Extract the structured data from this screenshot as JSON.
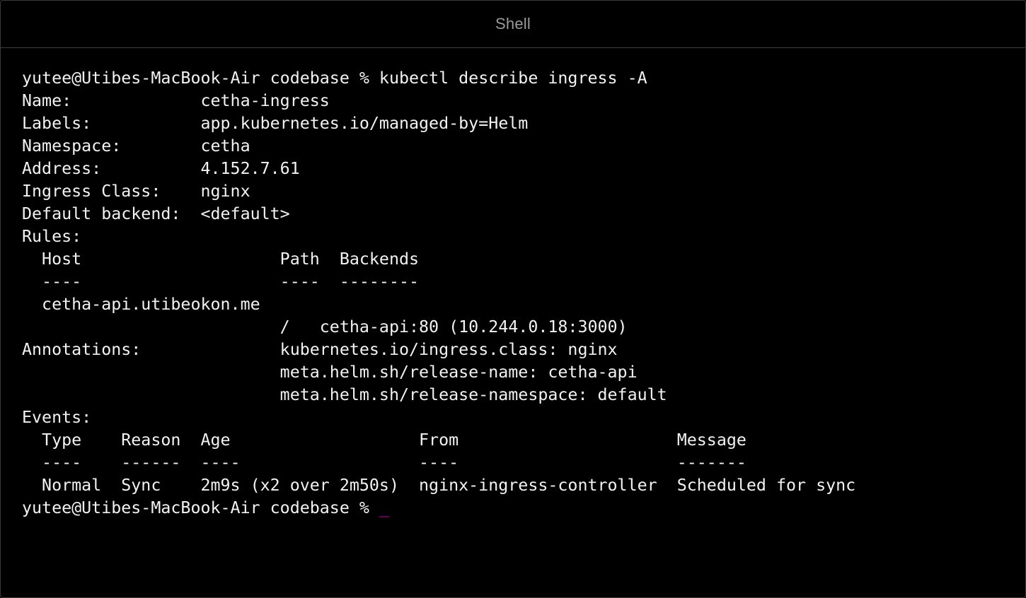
{
  "window": {
    "title": "Shell"
  },
  "terminal": {
    "lines": [
      "yutee@Utibes-MacBook-Air codebase % kubectl describe ingress -A",
      "Name:             cetha-ingress",
      "Labels:           app.kubernetes.io/managed-by=Helm",
      "Namespace:        cetha",
      "Address:          4.152.7.61",
      "Ingress Class:    nginx",
      "Default backend:  <default>",
      "Rules:",
      "  Host                    Path  Backends",
      "  ----                    ----  --------",
      "  cetha-api.utibeokon.me",
      "                          /   cetha-api:80 (10.244.0.18:3000)",
      "Annotations:              kubernetes.io/ingress.class: nginx",
      "                          meta.helm.sh/release-name: cetha-api",
      "                          meta.helm.sh/release-namespace: default",
      "Events:",
      "  Type    Reason  Age                   From                      Message",
      "  ----    ------  ----                  ----                      -------",
      "  Normal  Sync    2m9s (x2 over 2m50s)  nginx-ingress-controller  Scheduled for sync"
    ],
    "prompt": "yutee@Utibes-MacBook-Air codebase % ",
    "cursor": "_",
    "cursor_color": "#d400d4",
    "text_color": "#f2f2f2",
    "background_color": "#000000"
  }
}
